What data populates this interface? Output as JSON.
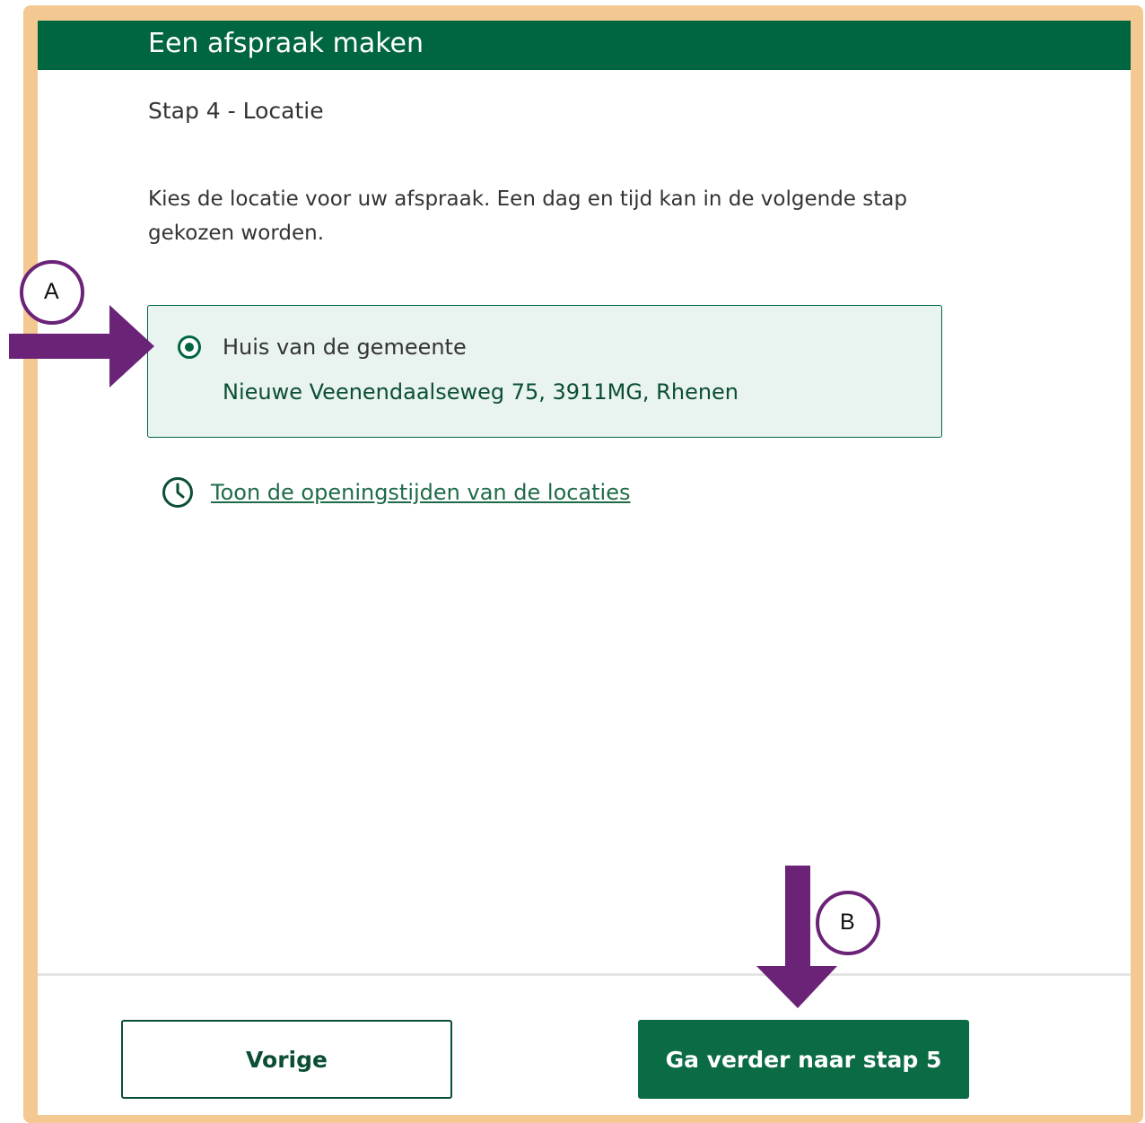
{
  "header": {
    "title": "Een afspraak maken"
  },
  "step": {
    "title": "Stap 4 - Locatie"
  },
  "intro": {
    "text": "Kies de locatie voor uw afspraak. Een dag en tijd kan in de volgende stap gekozen worden."
  },
  "location": {
    "selected": true,
    "name": "Huis van de gemeente",
    "address": "Nieuwe Veenendaalseweg 75, 3911MG, Rhenen"
  },
  "hours_link": {
    "label": "Toon de openingstijden van de locaties",
    "icon": "clock-icon"
  },
  "footer": {
    "prev_label": "Vorige",
    "next_label": "Ga verder naar stap 5"
  },
  "annotations": {
    "a_label": "A",
    "b_label": "B"
  },
  "colors": {
    "brand_green": "#006640",
    "card_background": "#e9f3ef",
    "frame": "#f3c891",
    "annotation_purple": "#6b2377"
  }
}
